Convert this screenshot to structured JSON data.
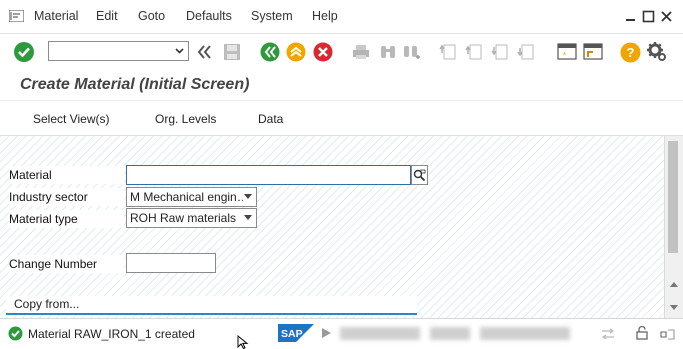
{
  "menubar": {
    "items": [
      "Material",
      "Edit",
      "Goto",
      "Defaults",
      "System",
      "Help"
    ]
  },
  "toolbar": {
    "command_value": "",
    "icons": [
      "enter-icon",
      "back-double-icon",
      "save-icon",
      "back-icon",
      "exit-icon",
      "cancel-icon",
      "print-icon",
      "find-icon",
      "find-next-icon",
      "first-page-icon",
      "previous-page-icon",
      "next-page-icon",
      "last-page-icon",
      "new-session-icon",
      "shortcut-icon",
      "help-icon",
      "customize-icon"
    ]
  },
  "header": {
    "title": "Create Material (Initial Screen)"
  },
  "appbar": {
    "select_views": "Select View(s)",
    "org_levels": "Org. Levels",
    "data": "Data"
  },
  "form": {
    "material_label": "Material",
    "material_value": "",
    "industry_label": "Industry sector",
    "industry_value": "M Mechanical engin…",
    "material_type_label": "Material type",
    "material_type_value": "ROH Raw materials",
    "change_number_label": "Change Number",
    "change_number_value": "",
    "copy_from_label": "Copy from..."
  },
  "status": {
    "message": "Material RAW_IRON_1 created",
    "type": "success"
  },
  "colors": {
    "enter_green": "#2e9a3c",
    "nav_green": "#2e9a3c",
    "exit_orange": "#f0a500",
    "cancel_red": "#d9282f",
    "help_orange": "#f0a500",
    "sap_blue": "#1b74c5"
  }
}
